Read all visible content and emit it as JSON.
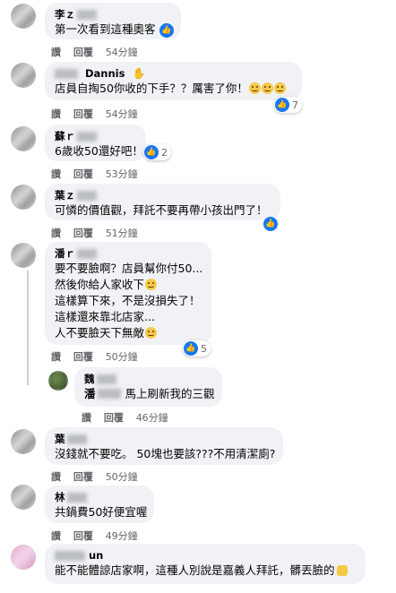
{
  "actions": {
    "like": "讚",
    "reply": "回覆"
  },
  "comments": [
    {
      "name": "李ｚ",
      "text": "第一次看到這種奧客",
      "time": "54分鐘",
      "reaction_count": ""
    },
    {
      "name": "Dannis",
      "text": "店員自掏50你收的下手？？厲害了你！",
      "time": "54分鐘",
      "reaction_count": "7"
    },
    {
      "name": "蘇ｒ",
      "text": "6歲收50還好吧！",
      "time": "53分鐘",
      "reaction_count": "2"
    },
    {
      "name": "葉ｚ",
      "text": "可憐的價值觀，拜託不要再帶小孩出門了！",
      "time": "51分鐘",
      "reaction_count": ""
    },
    {
      "name": "潘ｒ",
      "lines": [
        "要不要臉啊？店員幫你付50...",
        "然後你給人家收下",
        "這樣算下來，不是沒損失了！",
        "這樣還來靠北店家...",
        "人不要臉天下無敵"
      ],
      "time": "50分鐘",
      "reaction_count": "5"
    },
    {
      "name": "魏",
      "mention": "潘",
      "text": "馬上刷新我的三觀",
      "time": "46分鐘"
    },
    {
      "name": "葉",
      "text": "沒錢就不要吃。 50塊也要該???不用清潔廁?",
      "time": "50分鐘"
    },
    {
      "name": "林",
      "text": "共鍋費50好便宜喔",
      "time": "49分鐘"
    },
    {
      "name": "un",
      "text": "能不能體諒店家啊，這種人別說是嘉義人拜託，髒丟臉的",
      "time": ""
    }
  ]
}
